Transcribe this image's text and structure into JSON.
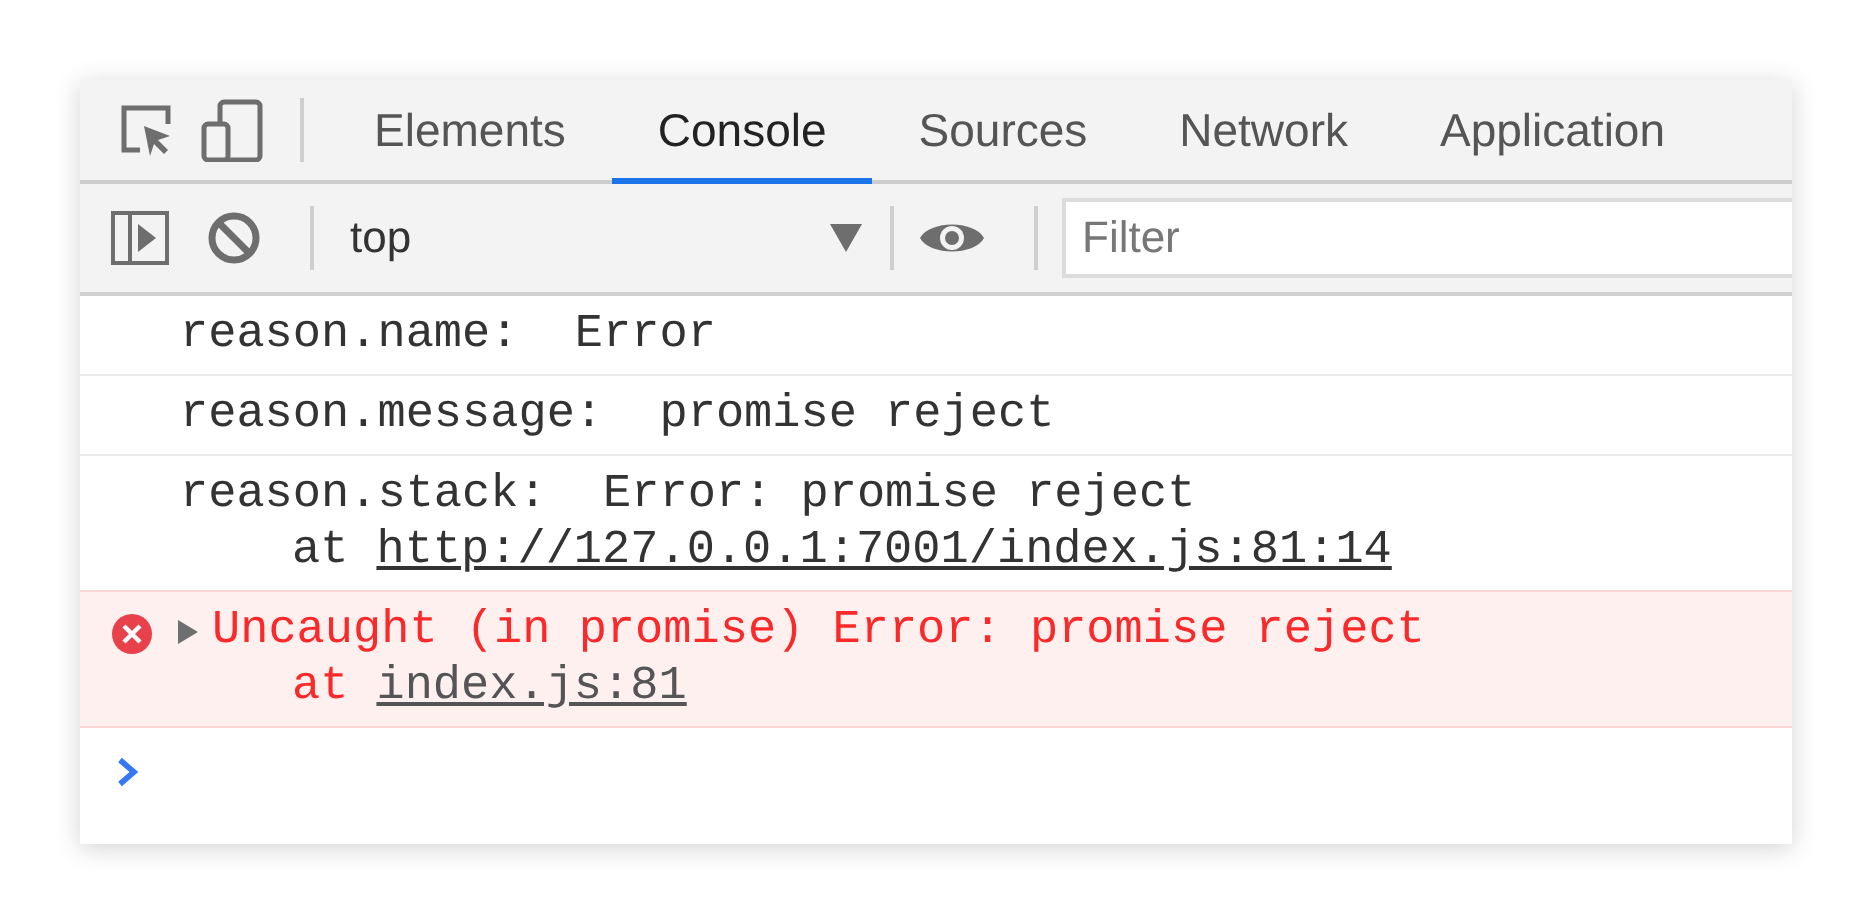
{
  "tabs": [
    {
      "label": "Elements",
      "selected": false
    },
    {
      "label": "Console",
      "selected": true
    },
    {
      "label": "Sources",
      "selected": false
    },
    {
      "label": "Network",
      "selected": false
    },
    {
      "label": "Application",
      "selected": false
    }
  ],
  "toolbar": {
    "context": "top",
    "filter": {
      "placeholder": "Filter"
    }
  },
  "messages": [
    {
      "kind": "log",
      "text": "reason.name:  Error"
    },
    {
      "kind": "log",
      "text": "reason.message:  promise reject"
    },
    {
      "kind": "log",
      "text": "reason.stack:  Error: promise reject",
      "trace": {
        "prefix": "at",
        "link": "http://127.0.0.1:7001/index.js:81:14"
      }
    },
    {
      "kind": "error",
      "expanded": false,
      "text": "Uncaught (in promise) Error: promise reject",
      "trace": {
        "prefix": "at",
        "link": "index.js:81"
      }
    }
  ]
}
